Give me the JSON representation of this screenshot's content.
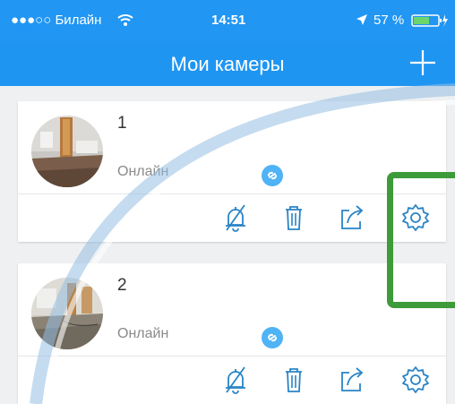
{
  "statusbar": {
    "carrier": "●●●○○ Билайн",
    "time": "14:51",
    "battery": "57 %"
  },
  "navbar": {
    "title": "Мои камеры",
    "add_icon": "plus-icon"
  },
  "cameras": [
    {
      "name": "1",
      "status": "Онлайн"
    },
    {
      "name": "2",
      "status": "Онлайн"
    }
  ],
  "icons": {
    "link": "link-icon",
    "alarm_off": "bell-off-icon",
    "delete": "trash-icon",
    "share": "share-icon",
    "settings": "gear-icon"
  },
  "colors": {
    "header": "#1f95f2",
    "accent": "#2a84c6",
    "highlight": "#3e9b3a"
  }
}
